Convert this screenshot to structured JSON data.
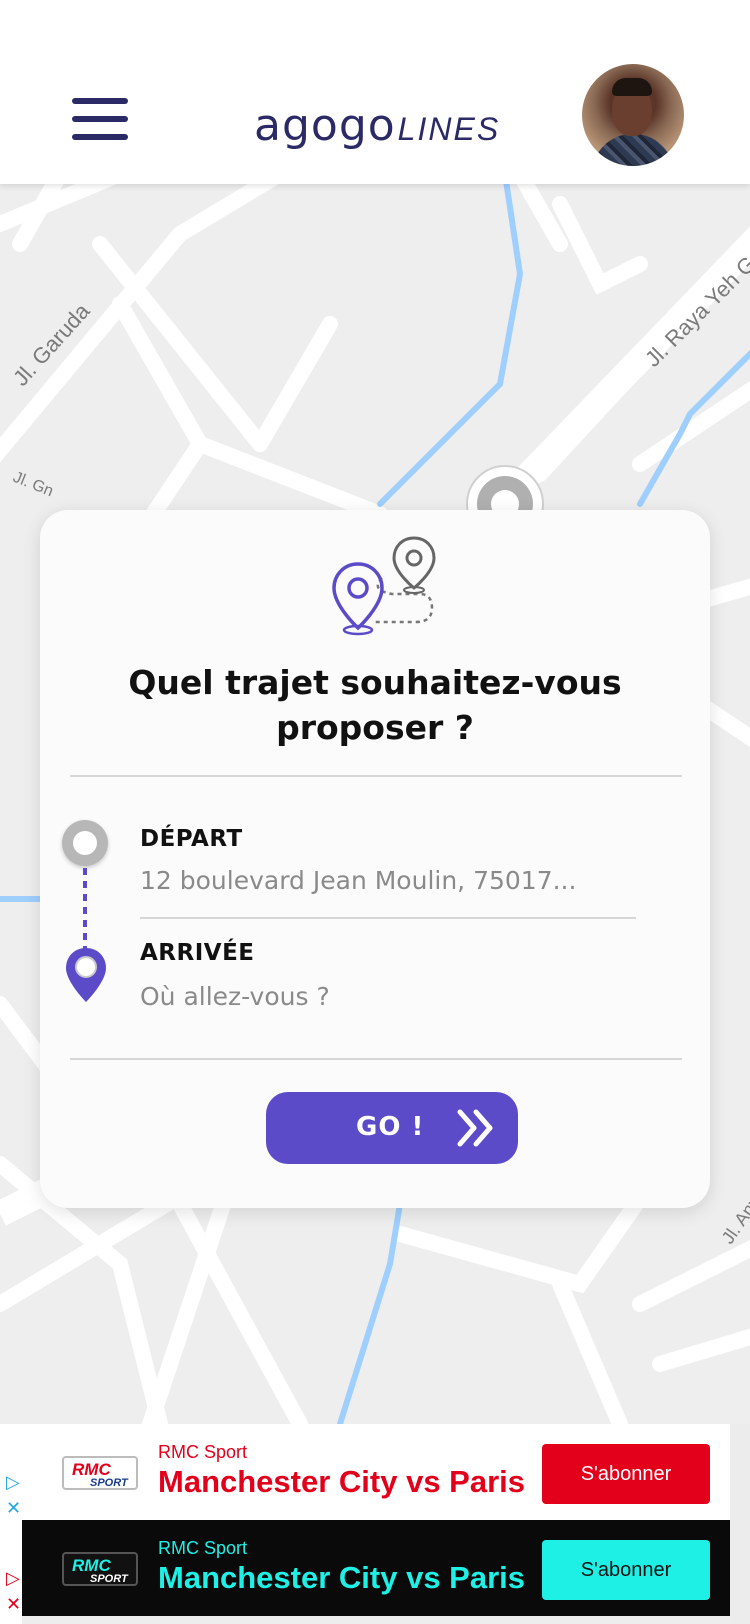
{
  "app": {
    "logo_main": "agogo",
    "logo_sub": "LINES"
  },
  "map": {
    "streets": [
      "Jl. Garuda",
      "Jl. Raya Yeh Ga",
      "Jl. Gn",
      "Jl. Anyel"
    ]
  },
  "card": {
    "title": "Quel trajet souhaitez-vous proposer ?",
    "departure_label": "DÉPART",
    "departure_value": "12 boulevard Jean Moulin, 75017...",
    "arrival_label": "ARRIVÉE",
    "arrival_placeholder": "Où allez-vous ?",
    "go_label": "GO !"
  },
  "colors": {
    "brand": "#2b2a66",
    "accent": "#5b4bc9",
    "ad_red": "#e3001b",
    "ad_cyan": "#1ff0e6"
  },
  "ads": [
    {
      "logo": "RMC SPORT",
      "brand": "RMC Sport",
      "headline": "Manchester City vs Paris",
      "cta": "S'abonner"
    },
    {
      "logo": "RMC SPORT",
      "brand": "RMC Sport",
      "headline": "Manchester City vs Paris",
      "cta": "S'abonner"
    }
  ]
}
